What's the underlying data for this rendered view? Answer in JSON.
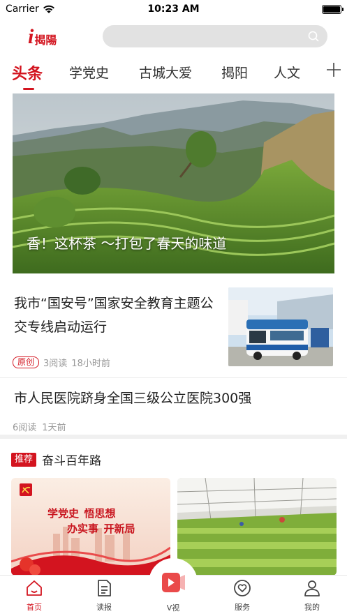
{
  "status_bar": {
    "carrier": "Carrier",
    "time": "10:23 AM"
  },
  "header": {
    "logo_i": "i",
    "logo_text": "揭陽",
    "search_placeholder": ""
  },
  "tabs": [
    {
      "label": "头条",
      "active": true
    },
    {
      "label": "学党史"
    },
    {
      "label": "古城大爱"
    },
    {
      "label": "揭阳"
    },
    {
      "label": "人文"
    }
  ],
  "hero": {
    "caption": "香！这杯茶 ～打包了春天的味道"
  },
  "articles": [
    {
      "title": "我市“国安号”国家安全教育主题公交专线启动运行",
      "tag": "原创",
      "reads": "3阅读",
      "time": "18小时前"
    },
    {
      "title": "市人民医院跻身全国三级公立医院300强",
      "reads": "6阅读",
      "time": "1天前"
    }
  ],
  "recommend": {
    "tag": "推荐",
    "title": "奋斗百年路",
    "card1": {
      "line1": "学党史  悟思想",
      "line2": "办实事  开新局"
    }
  },
  "bottom_nav": [
    {
      "label": "首页",
      "icon": "home-icon",
      "active": true
    },
    {
      "label": "读报",
      "icon": "newspaper-icon"
    },
    {
      "label": "V视",
      "icon": "video-icon"
    },
    {
      "label": "服务",
      "icon": "heart-service-icon"
    },
    {
      "label": "我的",
      "icon": "user-icon"
    }
  ],
  "colors": {
    "accent": "#d3141f",
    "search_bg": "#e2e2e2"
  }
}
